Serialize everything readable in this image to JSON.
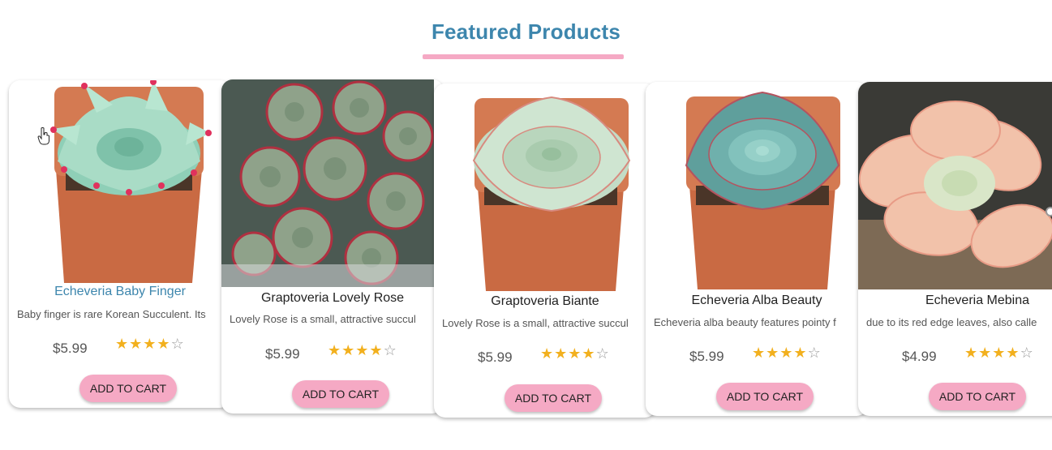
{
  "section": {
    "title": "Featured Products",
    "accent_color": "#3d86ad",
    "underline_color": "#f5a9c4"
  },
  "products": [
    {
      "name": "Echeveria Baby Finger",
      "description": "Baby finger is rare Korean Succulent. Its",
      "price": "$5.99",
      "rating": 4,
      "rating_max": 5,
      "button": "ADD TO CART",
      "image": "succulent-pale-green-pink-tips-in-terracotta-pot"
    },
    {
      "name": "Graptoveria Lovely Rose",
      "description": "Lovely Rose is a small, attractive succul",
      "price": "$5.99",
      "rating": 4,
      "rating_max": 5,
      "button": "ADD TO CART",
      "image": "cluster-of-green-rosettes-with-red-edges"
    },
    {
      "name": "Graptoveria Biante",
      "description": "Lovely Rose is a small, attractive succul",
      "price": "$5.99",
      "rating": 4,
      "rating_max": 5,
      "button": "ADD TO CART",
      "image": "pale-green-rosette-in-terracotta-pot"
    },
    {
      "name": "Echeveria Alba Beauty",
      "description": "Echeveria alba beauty features pointy f",
      "price": "$5.99",
      "rating": 4,
      "rating_max": 5,
      "button": "ADD TO CART",
      "image": "blue-green-rosette-in-terracotta-pot"
    },
    {
      "name": "Echeveria Mebina",
      "description": "due to its red edge leaves, also calle",
      "price": "$4.99",
      "rating": 4,
      "rating_max": 5,
      "button": "ADD TO CART",
      "image": "peach-pink-plump-succulent-closeup"
    }
  ]
}
